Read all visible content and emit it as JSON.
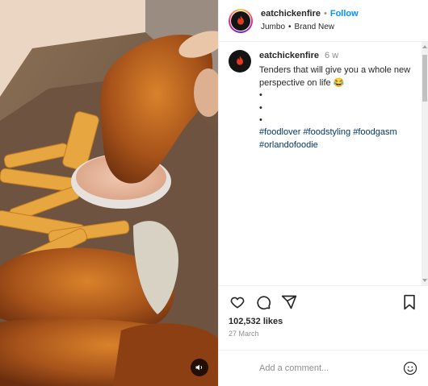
{
  "header": {
    "username": "eatchickenfire",
    "separator": "•",
    "follow_label": "Follow",
    "subtitle_primary": "Jumbo",
    "subtitle_separator": "•",
    "subtitle_secondary": "Brand New"
  },
  "caption": {
    "username": "eatchickenfire",
    "time": "6 w",
    "text": "Tenders that will give you a whole new perspective on life 😂",
    "bullets": [
      "•",
      "•",
      "•"
    ],
    "hashtags": [
      "#foodlover",
      "#foodstyling",
      "#foodgasm",
      "#orlandofoodie"
    ]
  },
  "stats": {
    "likes": "102,532 likes",
    "date": "27 March"
  },
  "comment_box": {
    "placeholder": "Add a comment..."
  },
  "icons": {
    "like": "heart-icon",
    "comment": "comment-icon",
    "share": "share-icon",
    "save": "bookmark-icon",
    "sound": "speaker-icon",
    "emoji": "emoji-icon"
  },
  "colors": {
    "follow_blue": "#0095f6",
    "hashtag": "#00376b",
    "muted": "#8e8e8e"
  }
}
